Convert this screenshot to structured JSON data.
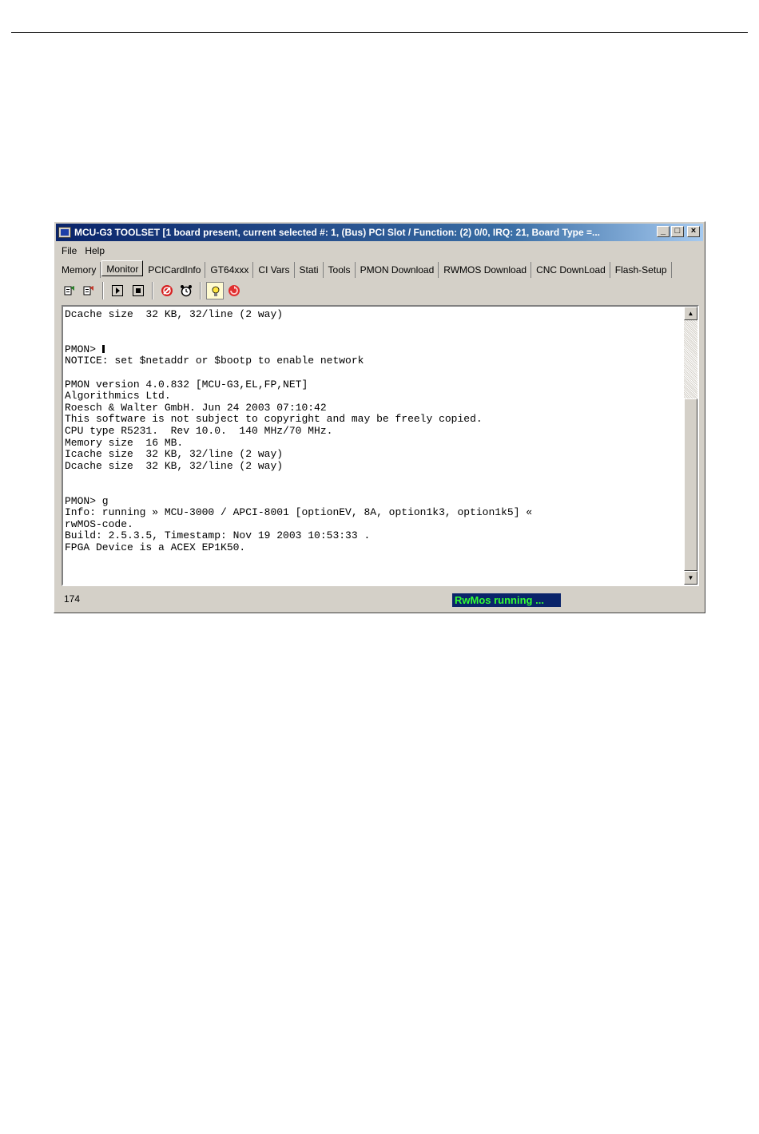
{
  "window": {
    "title": "MCU-G3 TOOLSET [1 board present, current selected #: 1, (Bus) PCI Slot / Function: (2) 0/0, IRQ: 21, Board Type =...",
    "controls": {
      "minimize": "_",
      "maximize": "□",
      "close": "×"
    }
  },
  "menu": {
    "items": [
      "File",
      "Help"
    ]
  },
  "tabs": [
    {
      "label": "Memory",
      "active": false
    },
    {
      "label": "Monitor",
      "active": true
    },
    {
      "label": "PCICardInfo",
      "active": false
    },
    {
      "label": "GT64xxx",
      "active": false
    },
    {
      "label": "CI Vars",
      "active": false
    },
    {
      "label": "Stati",
      "active": false
    },
    {
      "label": "Tools",
      "active": false
    },
    {
      "label": "PMON Download",
      "active": false
    },
    {
      "label": "RWMOS Download",
      "active": false
    },
    {
      "label": "CNC DownLoad",
      "active": false
    },
    {
      "label": "Flash-Setup",
      "active": false
    }
  ],
  "toolbar": {
    "icons": [
      "connect-icon",
      "disconnect-icon",
      "step-icon",
      "stop-icon",
      "halt-icon",
      "alarm-clock-icon",
      "lightbulb-icon",
      "reset-icon"
    ]
  },
  "terminal": {
    "lines": [
      "Dcache size  32 KB, 32/line (2 way)",
      "",
      "",
      "PMON> ",
      "NOTICE: set $netaddr or $bootp to enable network",
      "",
      "PMON version 4.0.832 [MCU-G3,EL,FP,NET]",
      "Algorithmics Ltd.",
      "Roesch & Walter GmbH. Jun 24 2003 07:10:42",
      "This software is not subject to copyright and may be freely copied.",
      "CPU type R5231.  Rev 10.0.  140 MHz/70 MHz.",
      "Memory size  16 MB.",
      "Icache size  32 KB, 32/line (2 way)",
      "Dcache size  32 KB, 32/line (2 way)",
      "",
      "",
      "PMON> g",
      "Info: running » MCU-3000 / APCI-8001 [optionEV, 8A, option1k3, option1k5] «",
      "rwMOS-code.",
      "Build: 2.5.3.5, Timestamp: Nov 19 2003 10:53:33 .",
      "FPGA Device is a ACEX EP1K50."
    ],
    "cursor_line": 3
  },
  "status": {
    "count": "174",
    "badge": "RwMos running ...",
    "badge_bg": "#0a246a",
    "badge_fg": "#33ff33"
  }
}
